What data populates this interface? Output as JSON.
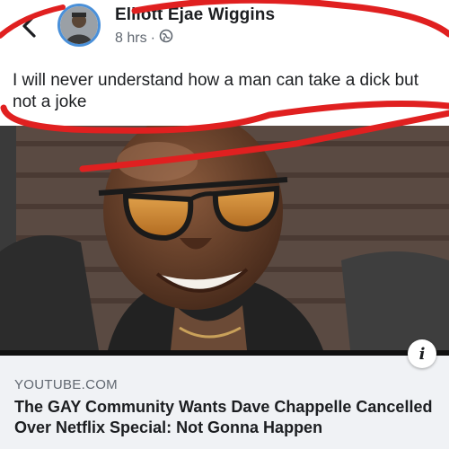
{
  "post": {
    "author": "Elliott Ejae Wiggins",
    "timestamp": "8 hrs",
    "separator": "·",
    "privacy_icon": "globe-icon",
    "text": "I will never understand how a man can take a dick but not a joke"
  },
  "nav": {
    "back_icon": "chevron-left-icon"
  },
  "link_preview": {
    "domain": "YOUTUBE.COM",
    "title": "The GAY Community Wants Dave Chappelle Cancelled Over Netflix Special: Not Gonna Happen",
    "info_icon": "info-icon",
    "info_glyph": "i"
  },
  "colors": {
    "annotation": "#e02020",
    "avatar_ring": "#4a90d9",
    "card_bg": "#f0f2f5"
  }
}
